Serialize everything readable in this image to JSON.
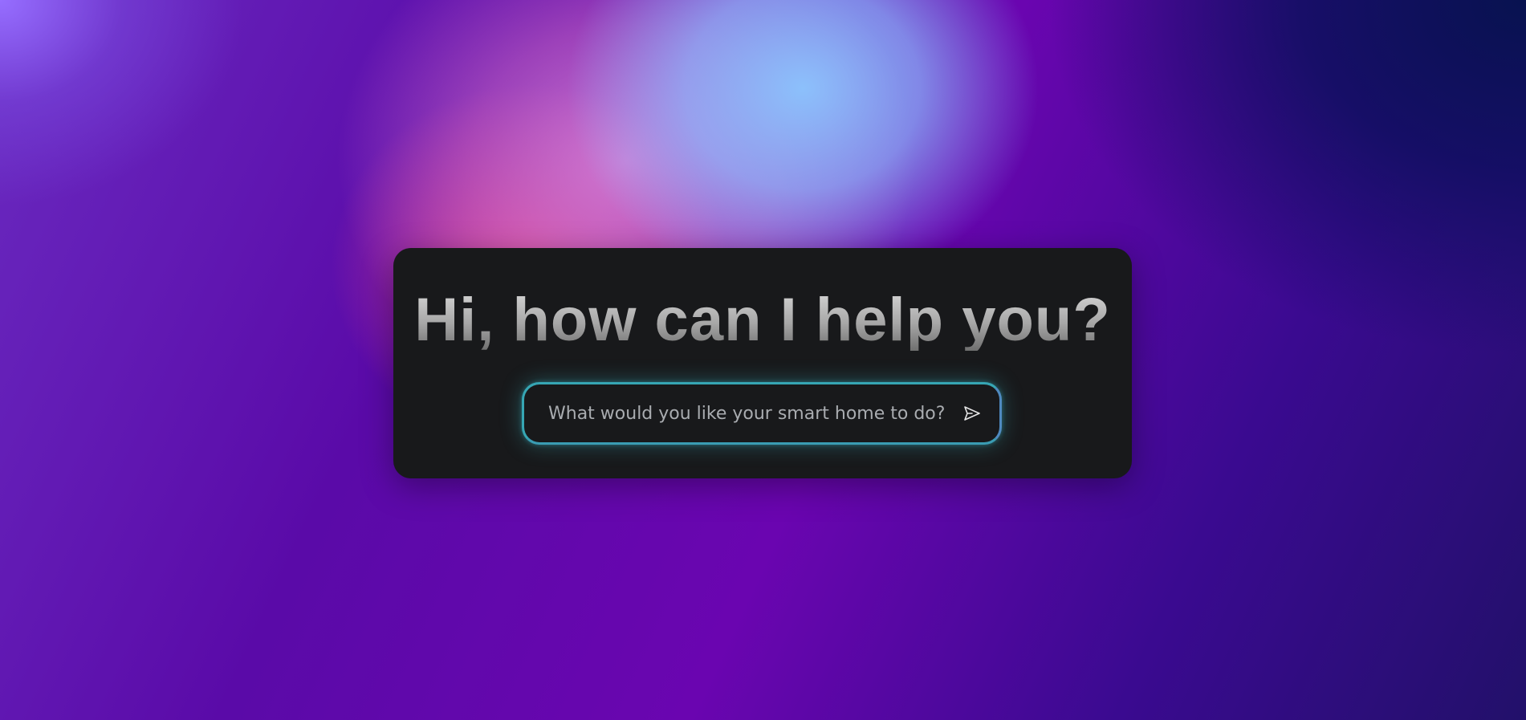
{
  "assistant": {
    "greeting": "Hi, how can I help you?",
    "input": {
      "placeholder": "What would you like your smart home to do?",
      "value": ""
    },
    "send_button": {
      "icon": "send-icon",
      "aria_label": "Send"
    }
  },
  "colors": {
    "card_background": "#18191b",
    "input_border": "#36a6b4",
    "placeholder_text": "#a9acb0",
    "heading_gradient_top": "#d6d6d6",
    "heading_gradient_bottom": "#6f6f6f"
  }
}
